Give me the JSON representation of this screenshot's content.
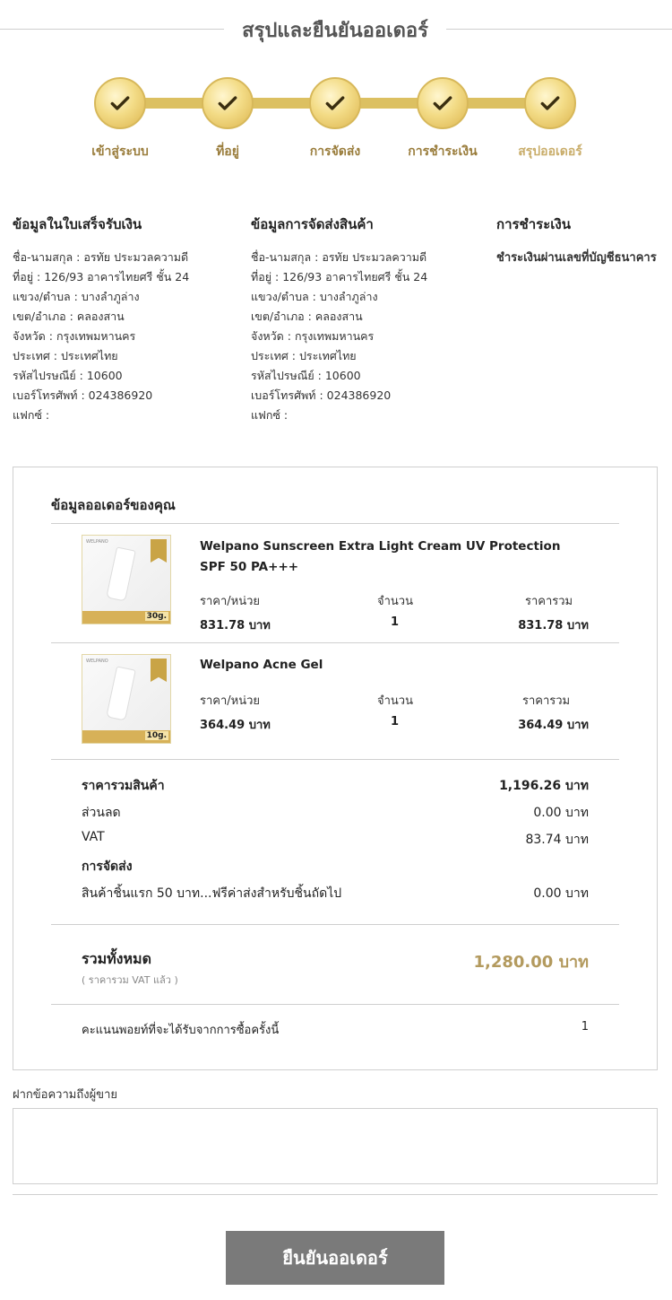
{
  "page": {
    "title": "สรุปและยืนยันออเดอร์"
  },
  "steps": [
    {
      "label": "เข้าสู่ระบบ"
    },
    {
      "label": "ที่อยู่"
    },
    {
      "label": "การจัดส่ง"
    },
    {
      "label": "การชำระเงิน"
    },
    {
      "label": "สรุปออเดอร์"
    }
  ],
  "billing": {
    "title": "ข้อมูลในใบเสร็จรับเงิน",
    "rows": [
      "ชื่อ-นามสกุล : อรทัย ประมวลความดี",
      "ที่อยู่ :  126/93 อาคารไทยศรี ชั้น 24",
      "แขวง/ตำบล : บางลำภูล่าง",
      "เขต/อำเภอ : คลองสาน",
      "จังหวัด : กรุงเทพมหานคร",
      "ประเทศ : ประเทศไทย",
      "รหัสไปรษณีย์ : 10600",
      "เบอร์โทรศัพท์ : 024386920",
      "แฟกซ์ :"
    ]
  },
  "shipping": {
    "title": "ข้อมูลการจัดส่งสินค้า",
    "rows": [
      "ชื่อ-นามสกุล : อรทัย ประมวลความดี",
      "ที่อยู่ :  126/93 อาคารไทยศรี ชั้น 24",
      "แขวง/ตำบล : บางลำภูล่าง",
      "เขต/อำเภอ : คลองสาน",
      "จังหวัด : กรุงเทพมหานคร",
      "ประเทศ : ประเทศไทย",
      "รหัสไปรษณีย์ : 10600",
      "เบอร์โทรศัพท์ : 024386920",
      "แฟกซ์ :"
    ]
  },
  "payment": {
    "title": "การชำระเงิน",
    "method": "ชำระเงินผ่านเลขที่บัญชีธนาคาร"
  },
  "order": {
    "title": "ข้อมูลออเดอร์ของคุณ",
    "col_price": "ราคา/หน่วย",
    "col_qty": "จำนวน",
    "col_total": "ราคารวม",
    "items": [
      {
        "name": "Welpano Sunscreen Extra Light Cream UV Protection SPF 50 PA+++",
        "price": "831.78 บาท",
        "qty": "1",
        "total": "831.78 บาท",
        "image_size": "30g."
      },
      {
        "name": "Welpano Acne Gel",
        "price": "364.49 บาท",
        "qty": "1",
        "total": "364.49 บาท",
        "image_size": "10g."
      }
    ]
  },
  "summary": {
    "subtotal_label": "ราคารวมสินค้า",
    "subtotal_value": "1,196.26 บาท",
    "discount_label": "ส่วนลด",
    "discount_value": "0.00 บาท",
    "vat_label": "VAT",
    "vat_value": "83.74 บาท",
    "shipping_label": "การจัดส่ง",
    "shipping_desc": "สินค้าชิ้นแรก 50 บาท...ฟรีค่าส่งสำหรับชิ้นถัดไป",
    "shipping_value": "0.00 บาท",
    "total_label": "รวมทั้งหมด",
    "total_note": "( ราคารวม VAT แล้ว )",
    "total_value": "1,280.00 บาท",
    "points_label": "คะแนนพอยท์ที่จะได้รับจากการซื้อครั้งนี้",
    "points_value": "1"
  },
  "message": {
    "label": "ฝากข้อความถึงผู้ขาย",
    "value": ""
  },
  "confirm_label": "ยืนยันออเดอร์",
  "colors": {
    "gold": "#dcc061",
    "gold_text": "#b39a5e",
    "button": "#7a7a7a"
  }
}
